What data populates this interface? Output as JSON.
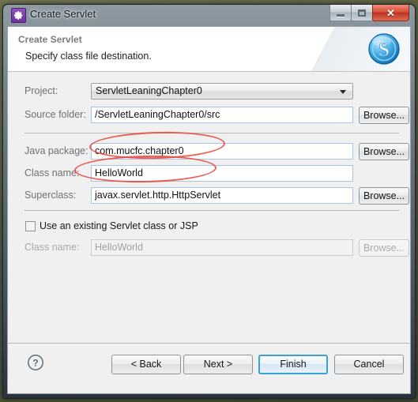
{
  "window": {
    "title": "Create Servlet",
    "icon": "gear-icon",
    "minimize_label": "Minimize",
    "maximize_label": "Maximize",
    "close_label": "✕"
  },
  "header": {
    "title": "Create Servlet",
    "subtitle": "Specify class file destination.",
    "logo": "eclipse-s-badge-icon"
  },
  "form": {
    "project": {
      "label": "Project:",
      "value": "ServletLeaningChapter0",
      "control": "combobox"
    },
    "source_folder": {
      "label": "Source folder:",
      "value": "/ServletLeaningChapter0/src",
      "browse": "Browse..."
    },
    "java_package": {
      "label": "Java package:",
      "value": "com.mucfc.chapter0",
      "browse": "Browse..."
    },
    "class_name": {
      "label": "Class name:",
      "value": "HelloWorld"
    },
    "superclass": {
      "label": "Superclass:",
      "value": "javax.servlet.http.HttpServlet",
      "browse": "Browse..."
    },
    "use_existing": {
      "label": "Use an existing Servlet class or JSP",
      "checked": false
    },
    "existing_class_name": {
      "label": "Class name:",
      "value": "HelloWorld",
      "browse": "Browse...",
      "disabled": true
    }
  },
  "buttons": {
    "help": "?",
    "back": "< Back",
    "next": "Next >",
    "finish": "Finish",
    "cancel": "Cancel"
  },
  "colors": {
    "accent": "#3c9fd6",
    "annotation": "#e8493f",
    "dialog_bg": "#eff0ef",
    "close_button": "#d64f39"
  }
}
